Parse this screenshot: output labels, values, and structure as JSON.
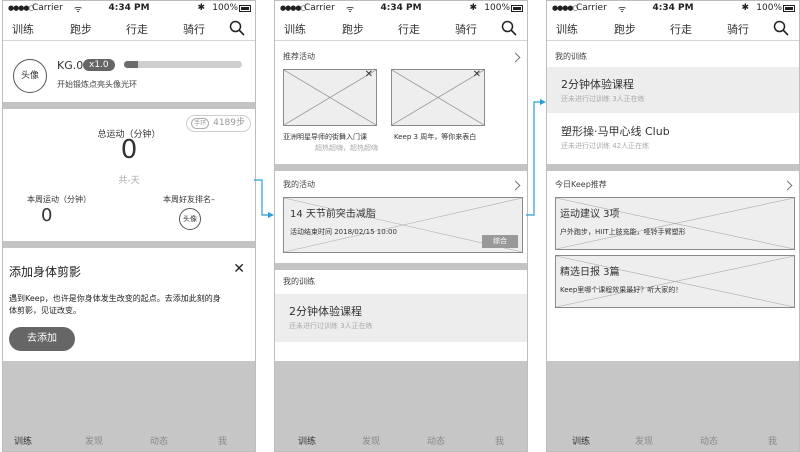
{
  "status": {
    "signal": "●●●●○",
    "carrier": "Carrier",
    "wifi": "ᯤ",
    "time": "4:34 PM",
    "bluetooth": "✱",
    "battery": "100%"
  },
  "tabs": [
    "训练",
    "跑步",
    "行走",
    "骑行"
  ],
  "bottom_nav": [
    "训练",
    "发现",
    "动态",
    "我"
  ],
  "screen1": {
    "avatar": "头像",
    "kg": "KG.0",
    "level": "x1.0",
    "progress": 0.12,
    "ring_tip": "开始锻炼点亮头像光环",
    "steps_icon": "手环",
    "steps": "4189步",
    "total_label": "总运动（分钟）",
    "total_value": "0",
    "days": "共-天",
    "week_label": "本周运动（分钟）",
    "week_value": "0",
    "rank_label": "本周好友排名–",
    "rank_avatar": "头像",
    "add_title": "添加身体剪影",
    "close": "✕",
    "add_desc": "遇到Keep，也许是你身体发生改变的起点。去添加此刻的身体剪影，见证改变。",
    "add_button": "去添加"
  },
  "screen2": {
    "recommended_title": "推荐活动",
    "recommended": [
      {
        "caption": "亚洲明星导师的街舞入门课",
        "sub": "超热超嗨，超热超嗨"
      },
      {
        "caption": "Keep 3 周年，等你来表白",
        "sub": ""
      }
    ],
    "my_events_title": "我的活动",
    "event": {
      "title": "14 天节前突击减脂",
      "time": "活动结束时间 2018/02/15 10:00",
      "badge": "综合"
    },
    "my_training_title": "我的训练",
    "course": {
      "title": "2分钟体验课程",
      "sub": "还未进行过训练 3人正在练"
    }
  },
  "screen3": {
    "my_training_title": "我的训练",
    "courses": [
      {
        "title": "2分钟体验课程",
        "sub": "还未进行过训练 3人正在练"
      },
      {
        "title": "塑形操·马甲心线 Club",
        "sub": "还未进行过训练 42人正在练"
      }
    ],
    "keep_recommend_title": "今日Keep推荐",
    "cards": [
      {
        "title": "运动建议 3项",
        "desc": "户外跑步，HIIT上肢充能，哑铃手臂塑形"
      },
      {
        "title": "精选日报 3篇",
        "desc": "Keep里哪个课程效果最好？听大家的！"
      }
    ]
  }
}
